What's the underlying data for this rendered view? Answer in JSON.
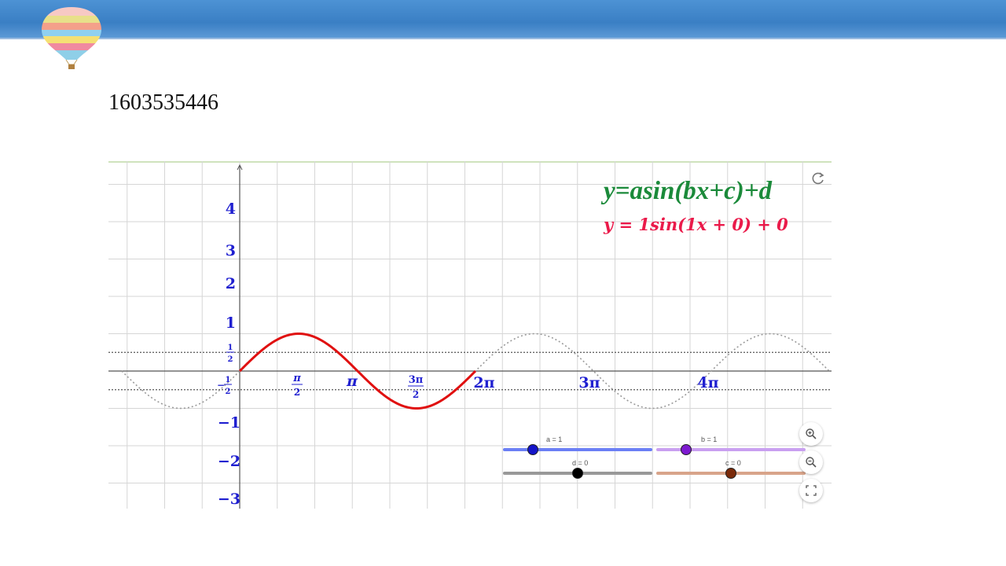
{
  "slide": {
    "number_text": "1603535446"
  },
  "applet": {
    "formula_generic": "y=asin(bx+c)+d",
    "formula_current": "y = 1sin(1x + 0) + 0",
    "y_tick_labels": [
      "4",
      "3",
      "2",
      "1",
      "−1",
      "−2",
      "−3"
    ],
    "y_fraction_labels": {
      "half_num": "1",
      "half_den": "2",
      "neg_half_sign": "−",
      "neg_half_num": "1",
      "neg_half_den": "2"
    },
    "x_tick_labels": {
      "pi_over_2_num": "π",
      "pi_over_2_den": "2",
      "pi": "π",
      "three_pi_over_2_num": "3π",
      "three_pi_over_2_den": "2",
      "two_pi": "2π",
      "three_pi": "3π",
      "four_pi": "4π"
    },
    "sliders": [
      {
        "id": "a",
        "label": "a = 1",
        "value": 1,
        "min": 0,
        "max": 5,
        "color": "#6b7ff5",
        "knob_color": "#1414c8"
      },
      {
        "id": "b",
        "label": "b = 1",
        "value": 1,
        "min": 0,
        "max": 5,
        "color": "#c9a0f0",
        "knob_color": "#7d1ad0"
      },
      {
        "id": "d",
        "label": "d = 0",
        "value": 0,
        "min": -5,
        "max": 5,
        "color": "#999999",
        "knob_color": "#000000"
      },
      {
        "id": "c",
        "label": "c = 0",
        "value": 0,
        "min": -5,
        "max": 5,
        "color": "#d8a48a",
        "knob_color": "#7a2a0a"
      }
    ],
    "colors": {
      "generic_formula": "#1b8a3a",
      "current_formula": "#ea1a4a",
      "curve": "#e01010",
      "reference_curve": "#9a9a9a",
      "axis_labels": "#1f1fd0"
    },
    "chart_data": {
      "type": "line",
      "series": [
        {
          "function": "sin(x)",
          "x_range": [
            0,
            6.2832
          ],
          "style": "solid"
        },
        {
          "function": "sin(x)",
          "x_range": [
            -3.1416,
            15.7
          ],
          "style": "dotted"
        }
      ],
      "dotted_horizontal_lines_y": [
        0.5,
        -0.5
      ],
      "xlim": [
        -4.7,
        24.2
      ],
      "ylim": [
        -3.6,
        5.2
      ],
      "grid": true
    },
    "icons": {
      "reset": "reset-icon",
      "zoom_in": "zoom-in-icon",
      "zoom_out": "zoom-out-icon",
      "fullscreen": "fullscreen-icon"
    }
  }
}
